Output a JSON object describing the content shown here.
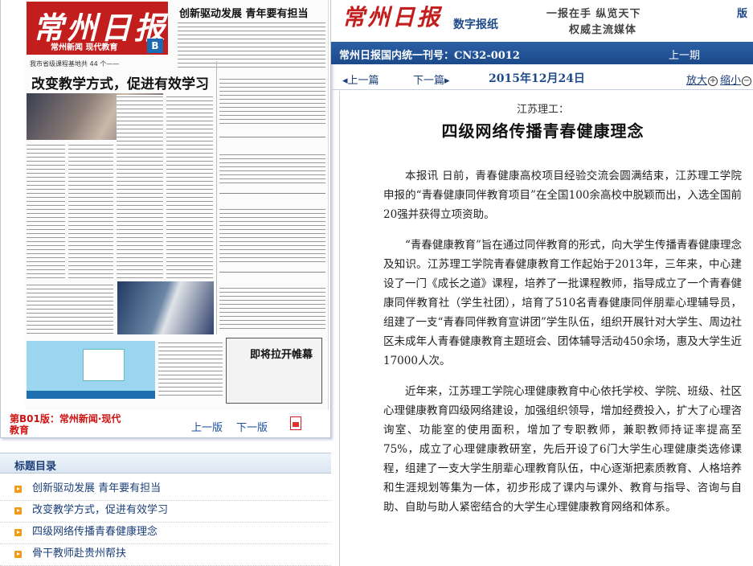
{
  "newspaper_thumb": {
    "masthead_logo": "常州日报",
    "masthead_sub": "常州新闻 现代教育",
    "badge": "B",
    "top_headline": "创新驱动发展 青年要有担当",
    "kicker": "我市省级课程基地共 44 个——",
    "main_headline": "改变教学方式，促进有效学习",
    "box_title": "即将拉开帷幕"
  },
  "left_panel": {
    "page_label": "第B01版：常州新闻·现代教育",
    "prev_page": "上一版",
    "next_page": "下一版",
    "pdf_icon": "pdf-icon"
  },
  "toc": {
    "header": "标题目录",
    "items": [
      "创新驱动发展 青年要有担当",
      "改变教学方式，促进有效学习",
      "四级网络传播青春健康理念",
      "骨干教师赴贵州帮扶"
    ]
  },
  "header": {
    "logo": "常州日报",
    "sub": "数字报纸",
    "slogan_line1": "一报在手 纵览天下",
    "slogan_line2": "权威主流媒体",
    "edge_tab": "版"
  },
  "bluebar": {
    "publication": "常州日报国内统一刊号：CN32-0012",
    "prev_issue": "上一期"
  },
  "nav": {
    "prev_article": "上一篇",
    "next_article": "下一篇",
    "date": "2015年12月24日",
    "zoom_in": "放大",
    "zoom_out": "缩小"
  },
  "article": {
    "subtitle": "江苏理工：",
    "title": "四级网络传播青春健康理念",
    "paragraphs": [
      "本报讯 日前，青春健康高校项目经验交流会圆满结束，江苏理工学院申报的“青春健康同伴教育项目”在全国100余高校中脱颖而出，入选全国前20强并获得立项资助。",
      "“青春健康教育”旨在通过同伴教育的形式，向大学生传播青春健康理念及知识。江苏理工学院青春健康教育工作起始于2013年，三年来，中心建设了一门《成长之道》课程，培养了一批课程教师，指导成立了一个青春健康同伴教育社（学生社团），培育了510名青春健康同伴朋辈心理辅导员，组建了一支“青春同伴教育宣讲团”学生队伍，组织开展针对大学生、周边社区未成年人青春健康教育主题班会、团体辅导活动450余场，惠及大学生近17000人次。",
      "近年来，江苏理工学院心理健康教育中心依托学校、学院、班级、社区心理健康教育四级网络建设，加强组织领导，增加经费投入，扩大了心理咨询室、功能室的使用面积，增加了专职教师，兼职教师持证率提高至75%，成立了心理健康教研室，先后开设了6门大学生心理健康类选修课程，组建了一支大学生朋辈心理教育队伍，中心逐渐把素质教育、人格培养和生涯规划等集为一体，初步形成了课内与课外、教育与指导、咨询与自助、自助与助人紧密结合的大学生心理健康教育网络和体系。"
    ]
  },
  "colors": {
    "brand_red": "#c31e1e",
    "nav_blue": "#1e4a8a",
    "bar_blue": "#2b5fa5",
    "bullet_orange": "#f39a14",
    "page_label_red": "#d01212"
  }
}
